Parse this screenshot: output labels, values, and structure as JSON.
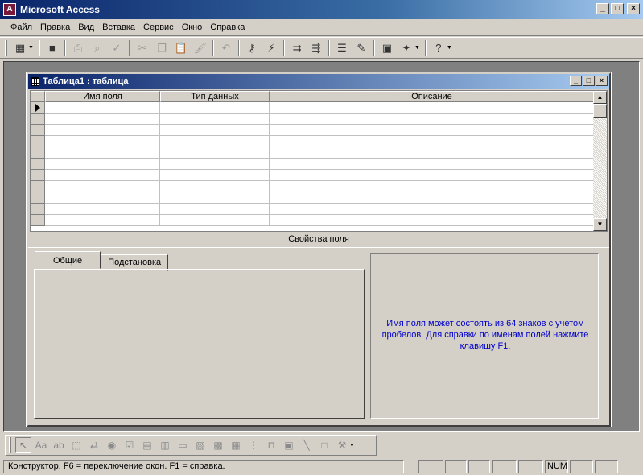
{
  "app": {
    "title": "Microsoft Access",
    "icon_letter": "A",
    "minimize": "_",
    "maximize": "□",
    "close": "×"
  },
  "menu": [
    "Файл",
    "Правка",
    "Вид",
    "Вставка",
    "Сервис",
    "Окно",
    "Справка"
  ],
  "toolbar_icons": [
    "view-icon",
    "save-icon",
    "print-icon",
    "print-preview-icon",
    "spelling-icon",
    "cut-icon",
    "copy-icon",
    "paste-icon",
    "format-painter-icon",
    "undo-icon",
    "primary-key-icon",
    "indexes-icon",
    "insert-rows-icon",
    "delete-rows-icon",
    "properties-icon",
    "build-icon",
    "database-window-icon",
    "new-object-icon",
    "help-icon"
  ],
  "child_window": {
    "title": "Таблица1 : таблица",
    "minimize": "_",
    "maximize": "□",
    "close": "×"
  },
  "grid": {
    "columns": [
      "Имя поля",
      "Тип данных",
      "Описание"
    ],
    "row_count": 11
  },
  "properties": {
    "label": "Свойства поля",
    "tabs": [
      "Общие",
      "Подстановка"
    ],
    "hint": "Имя поля может состоять из 64 знаков с учетом пробелов.  Для справки по именам полей нажмите клавишу F1."
  },
  "toolbox_icons": [
    "select-objects-icon",
    "label-icon",
    "textbox-icon",
    "option-group-icon",
    "toggle-button-icon",
    "option-button-icon",
    "checkbox-icon",
    "combobox-icon",
    "listbox-icon",
    "command-button-icon",
    "image-icon",
    "unbound-object-icon",
    "bound-object-icon",
    "page-break-icon",
    "tab-control-icon",
    "subform-icon",
    "line-icon",
    "rectangle-icon",
    "more-controls-icon"
  ],
  "status": {
    "message": "Конструктор.  F6 = переключение окон.  F1 = справка.",
    "num": "NUM"
  },
  "scroll": {
    "up": "▲",
    "down": "▼"
  }
}
